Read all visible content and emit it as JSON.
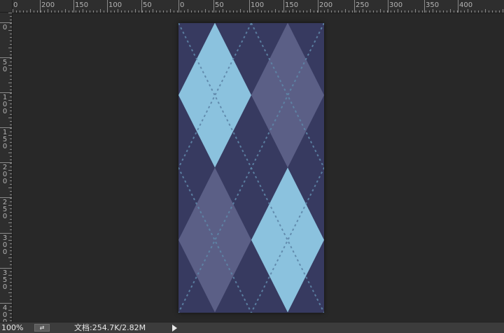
{
  "rulers": {
    "horizontal_labels": [
      "0",
      "200",
      "150",
      "100",
      "50",
      "0",
      "50",
      "100",
      "150",
      "200",
      "250",
      "300",
      "350",
      "400"
    ],
    "vertical_labels": [
      "0",
      "50",
      "100",
      "150",
      "200",
      "250",
      "300",
      "350",
      "400"
    ]
  },
  "document": {
    "pattern": "argyle",
    "colors": {
      "background": "#373a60",
      "light_diamond": "#8bc2de",
      "muted_diamond": "#5b5f86",
      "stitch": "#5e86a8"
    }
  },
  "status_bar": {
    "zoom": "100%",
    "button_icon": "view-toggle-icon",
    "doc_info": "文档:254.7K/2.82M",
    "menu_arrow_icon": "play-arrow-icon"
  }
}
